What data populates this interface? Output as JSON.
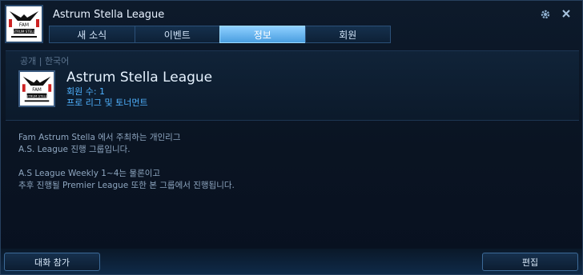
{
  "window": {
    "title": "Astrum Stella League"
  },
  "logo": {
    "top_text": "FAM",
    "main_text": "ASTRUM STELLA"
  },
  "tabs": [
    {
      "label": "새 소식"
    },
    {
      "label": "이벤트"
    },
    {
      "label": "정보",
      "active": true
    },
    {
      "label": "회원"
    }
  ],
  "header_icons": {
    "settings": "gear-icon",
    "close": "close-icon"
  },
  "info": {
    "visibility": "공개 | 한국어",
    "name": "Astrum Stella League",
    "members": "회원 수: 1",
    "type": "프로 리그 및 토너먼트"
  },
  "description": {
    "lines_1": [
      "Fam Astrum Stella 에서 주최하는 개인리그",
      "A.S. League 진행 그룹입니다."
    ],
    "lines_2": [
      "A.S League Weekly 1~4는 물론이고",
      "추후 진행될 Premier League 또한 본 그룹에서 진행됩니다."
    ]
  },
  "footer": {
    "join_chat": "대화 참가",
    "edit": "편집"
  },
  "colors": {
    "accent": "#4fb2ff",
    "active_tab": "#6ab8f0",
    "background": "#0a1422"
  }
}
